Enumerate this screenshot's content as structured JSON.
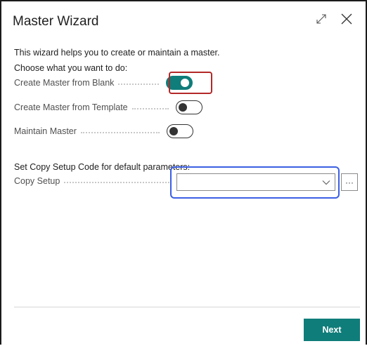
{
  "dialog": {
    "title": "Master Wizard",
    "expand_icon": "expand-icon",
    "close_icon": "close-icon"
  },
  "intro_text": "This wizard helps you to create or maintain a master.",
  "choose_heading": "Choose what you want to do:",
  "options": [
    {
      "label": "Create Master from Blank",
      "checked": true
    },
    {
      "label": "Create Master from Template",
      "checked": false
    },
    {
      "label": "Maintain Master",
      "checked": false
    }
  ],
  "copy_setup_heading": "Set Copy Setup Code for default parameters:",
  "copy_setup": {
    "label": "Copy Setup",
    "value": "",
    "more_label": "···"
  },
  "footer": {
    "next_label": "Next"
  },
  "colors": {
    "accent": "#0f7d7a",
    "highlight_red": "#b32828",
    "highlight_blue": "#3b5fe3"
  }
}
